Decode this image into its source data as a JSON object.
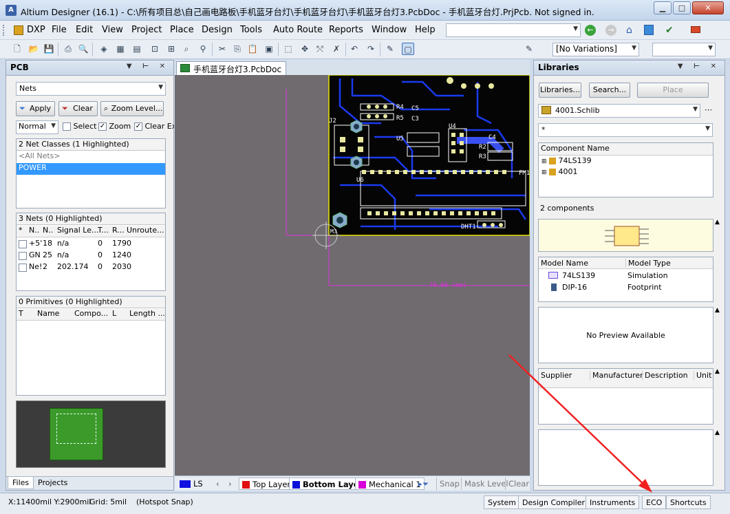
{
  "window": {
    "title": "Altium Designer (16.1) - C:\\所有项目总\\自己画电路板\\手机蓝牙台灯\\手机蓝牙台灯\\手机蓝牙台灯3.PcbDoc - 手机蓝牙台灯.PrjPcb. Not signed in.",
    "app_icon": "altium-icon"
  },
  "menu": {
    "items": [
      "DXP",
      "File",
      "Edit",
      "View",
      "Project",
      "Place",
      "Design",
      "Tools",
      "Auto Route",
      "Reports",
      "Window",
      "Help"
    ]
  },
  "toolbar": {
    "variations": "[No Variations]"
  },
  "pcb_panel": {
    "title": "PCB",
    "mode_select": "Nets",
    "apply": "Apply",
    "clear": "Clear",
    "zoom_level": "Zoom Level...",
    "normal": "Normal",
    "select_label": "Select",
    "zoom_label": "Zoom",
    "clear_exi": "Clear Exi",
    "net_classes_header": "2 Net Classes (1 Highlighted)",
    "net_classes": [
      "<All Nets>",
      "POWER"
    ],
    "nets_header": "3 Nets (0 Highlighted)",
    "nets_columns": [
      "*",
      "N..",
      "N..",
      "Signal Le...",
      "T...",
      "R...",
      "Unroute..."
    ],
    "nets_rows": [
      [
        "+5'",
        "18",
        "n/a",
        "0",
        "179",
        "0"
      ],
      [
        "GN",
        "25",
        "n/a",
        "0",
        "124",
        "0"
      ],
      [
        "Ne!",
        "2",
        "202.174",
        "0",
        "203",
        "0"
      ]
    ],
    "primitives_header": "0 Primitives (0 Highlighted)",
    "primitives_columns": [
      "T",
      "Name",
      "Compo...",
      "L",
      "Length ..."
    ],
    "bottom_tabs": [
      "Files",
      "Projects"
    ]
  },
  "document": {
    "tab_label": "手机蓝牙台灯3.PcbDoc",
    "labels": [
      "J2",
      "U5",
      "R4",
      "R5",
      "C5",
      "C3",
      "U4",
      "C4",
      "R2",
      "R3",
      "U6",
      "FM1",
      "DHT1",
      "M3"
    ],
    "dimension_label": "70.00 (mm)"
  },
  "layer_tabs": {
    "ls": "LS",
    "layers": [
      {
        "name": "Top Layer",
        "color": "#e01010"
      },
      {
        "name": "Bottom Layer",
        "color": "#0a10d8"
      },
      {
        "name": "Mechanical 1",
        "color": "#d800d8"
      }
    ],
    "snap": "Snap",
    "mask_level": "Mask Level",
    "clear": "Clear"
  },
  "libraries_panel": {
    "title": "Libraries",
    "libraries_btn": "Libraries...",
    "search_btn": "Search...",
    "place_btn": "Place",
    "library": "4001.Schlib",
    "filter": "*",
    "component_header": "Component Name",
    "components": [
      "74LS139",
      "4001"
    ],
    "count": "2 components",
    "model_header": [
      "Model Name",
      "Model Type"
    ],
    "models": [
      [
        "74LS139",
        "Simulation"
      ],
      [
        "DIP-16",
        "Footprint"
      ]
    ],
    "no_preview": "No Preview Available",
    "supplier_columns": [
      "Supplier",
      "Manufacturer",
      "Description",
      "Unit"
    ]
  },
  "statusbar": {
    "coords": "X:11400mil Y:2900mil",
    "grid": "Grid: 5mil",
    "snap": "(Hotspot Snap)",
    "buttons": [
      "System",
      "Design Compiler",
      "Instruments",
      "ECO",
      "Shortcuts"
    ]
  }
}
